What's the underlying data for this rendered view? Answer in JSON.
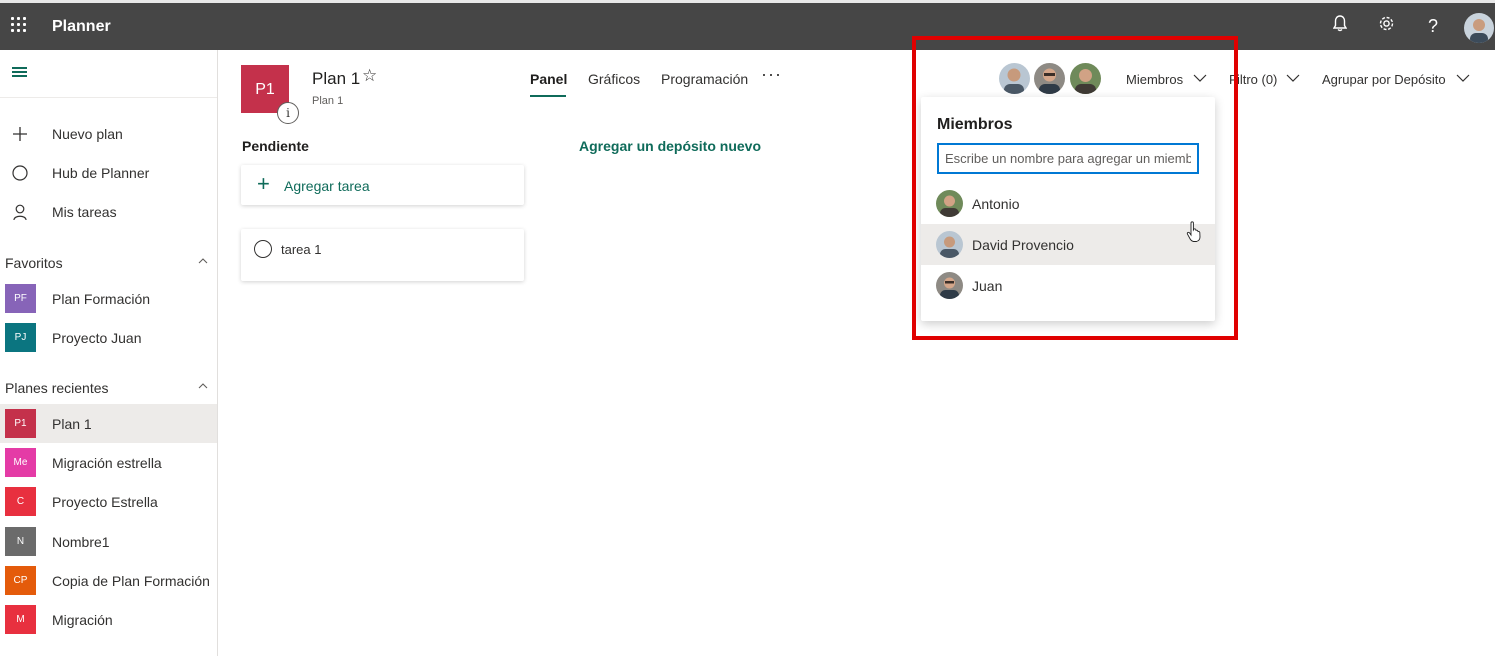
{
  "topbar": {
    "app_title": "Planner",
    "help_label": "?"
  },
  "sidebar": {
    "nav": [
      {
        "label": "Nuevo plan",
        "icon": "plus-icon"
      },
      {
        "label": "Hub de Planner",
        "icon": "hub-circle-icon"
      },
      {
        "label": "Mis tareas",
        "icon": "person-icon"
      }
    ],
    "favorites_label": "Favoritos",
    "favorites": [
      {
        "badge": "PF",
        "label": "Plan Formación",
        "color": "#8764b8"
      },
      {
        "badge": "PJ",
        "label": "Proyecto Juan",
        "color": "#0b7580"
      }
    ],
    "recent_label": "Planes recientes",
    "recent": [
      {
        "badge": "P1",
        "label": "Plan 1",
        "color": "#c4314b",
        "selected": true
      },
      {
        "badge": "Me",
        "label": "Migración estrella",
        "color": "#e43ba6"
      },
      {
        "badge": "C",
        "label": "Proyecto Estrella",
        "color": "#e8303f"
      },
      {
        "badge": "N",
        "label": "Nombre1",
        "color": "#6b6b6b"
      },
      {
        "badge": "CP",
        "label": "Copia de Plan Formación",
        "color": "#e45b0b"
      },
      {
        "badge": "M",
        "label": "Migración",
        "color": "#e8303f"
      }
    ]
  },
  "header": {
    "plan_badge": "P1",
    "plan_name": "Plan 1",
    "plan_subtitle": "Plan 1",
    "info_label": "i",
    "star_glyph": "☆",
    "tabs": [
      {
        "label": "Panel",
        "active": true
      },
      {
        "label": "Gráficos",
        "active": false
      },
      {
        "label": "Programación",
        "active": false
      }
    ],
    "more_glyph": "···",
    "members_label": "Miembros",
    "filter_label": "Filtro (0)",
    "group_label": "Agrupar por Depósito"
  },
  "board": {
    "bucket_title": "Pendiente",
    "add_task_label": "Agregar tarea",
    "tasks": [
      {
        "label": "tarea 1"
      }
    ],
    "add_bucket_label": "Agregar un depósito nuevo"
  },
  "members_popup": {
    "title": "Miembros",
    "input_placeholder": "Escribe un nombre para agregar un miembro",
    "members": [
      {
        "name": "Antonio",
        "hover": false
      },
      {
        "name": "David Provencio",
        "hover": true
      },
      {
        "name": "Juan",
        "hover": false
      }
    ]
  },
  "colors": {
    "accent": "#0f6b5a",
    "topbar": "#464646",
    "highlight": "#e00000",
    "input_focus": "#0078d4"
  }
}
